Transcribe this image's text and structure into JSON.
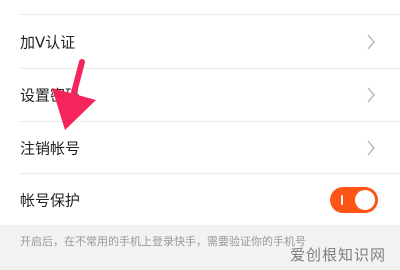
{
  "settings": {
    "items": [
      {
        "label": "加V认证",
        "type": "link"
      },
      {
        "label": "设置密码",
        "type": "link"
      },
      {
        "label": "注销帐号",
        "type": "link"
      },
      {
        "label": "帐号保护",
        "type": "toggle",
        "toggle_on": true
      }
    ],
    "footnote": "开启后，在不常用的手机上登录快手，需要验证你的手机号"
  },
  "watermark": "爱创根知识网",
  "colors": {
    "accent": "#fe5415",
    "annotation_arrow": "#f5245a"
  },
  "icons": {
    "chevron": "chevron-right-icon",
    "arrow": "red-arrow-annotation"
  }
}
